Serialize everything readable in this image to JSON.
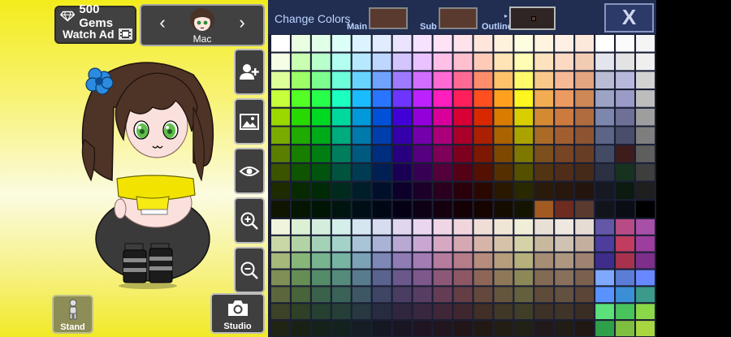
{
  "left": {
    "gems_label": "500 Gems",
    "watch_ad_label": "Watch Ad",
    "character_name": "Mac",
    "stand_label": "Stand",
    "studio_label": "Studio"
  },
  "panel": {
    "title": "Change Colors",
    "main_label": "Main",
    "sub_label": "Sub",
    "outline_label": "Outline",
    "close_label": "X",
    "main_color": "#5a3a2e",
    "sub_color": "#5a3a2e",
    "outline_color": "#2e2524"
  },
  "palette": {
    "upper_rows": [
      [
        "#ffffff",
        "#eaffe0",
        "#e2ffe8",
        "#dcfff8",
        "#dcf4ff",
        "#e2ecff",
        "#ece4ff",
        "#f6e2ff",
        "#ffe2f6",
        "#ffe2ea",
        "#ffe6dc",
        "#fff2dc",
        "#fffde0",
        "#fff4e0",
        "#fff0e6",
        "#fde8dc",
        "#ffffff",
        "#fbfbfb",
        "#f5f5f5"
      ],
      [
        "#f4ffe6",
        "#c9ffb1",
        "#b8ffcb",
        "#b2ffef",
        "#b6e9ff",
        "#bfd6ff",
        "#d4c5ff",
        "#e9c2ff",
        "#ffbfe7",
        "#ffbfce",
        "#ffcbb6",
        "#ffe4b6",
        "#fffcb4",
        "#fde3bd",
        "#fcd9c2",
        "#f2cbb3",
        "#e4e4ec",
        "#e3e3e3",
        "#efefef"
      ],
      [
        "#ddff9a",
        "#9cff67",
        "#7dff8f",
        "#6cffda",
        "#67d4ff",
        "#6fa3ff",
        "#9d7aff",
        "#d26dff",
        "#ff6ad3",
        "#ff6a94",
        "#ff8d6a",
        "#ffc26a",
        "#fff86a",
        "#f9c98a",
        "#f5b996",
        "#e2a57f",
        "#b9bdd4",
        "#b8b8dc",
        "#d2d2d2"
      ],
      [
        "#c6ff3c",
        "#53ff25",
        "#27ff4b",
        "#1bffc1",
        "#1bbcff",
        "#2a75ff",
        "#6d35ff",
        "#bc22ff",
        "#ff1fbd",
        "#ff1f5a",
        "#ff4f1f",
        "#ffa11f",
        "#fff51f",
        "#f2ad52",
        "#ec9a62",
        "#ce8757",
        "#9ca3c4",
        "#9a9bc7",
        "#bdbdbd"
      ],
      [
        "#9bd800",
        "#28d900",
        "#00d922",
        "#00d99e",
        "#0099d9",
        "#0050d9",
        "#4200d9",
        "#9300d9",
        "#d9009a",
        "#d90035",
        "#d92800",
        "#d97c00",
        "#d9cf00",
        "#d48a33",
        "#cd7a3f",
        "#b06c3f",
        "#7d87ad",
        "#6e7095",
        "#9e9e9e"
      ],
      [
        "#7aab00",
        "#1fab00",
        "#00ab1a",
        "#00ab7c",
        "#0079ab",
        "#003fab",
        "#3400ab",
        "#7300ab",
        "#ab0079",
        "#ab002a",
        "#ab2000",
        "#ab6200",
        "#aba300",
        "#a96b26",
        "#a35e30",
        "#8d5432",
        "#5d6586",
        "#4b4d6c",
        "#7e7e7e"
      ],
      [
        "#5a7e00",
        "#177e00",
        "#007e13",
        "#007e5b",
        "#00597e",
        "#002e7e",
        "#26007e",
        "#55007e",
        "#7e0059",
        "#7e001f",
        "#7e1800",
        "#7e4800",
        "#7e7800",
        "#7c4f1c",
        "#774424",
        "#673e25",
        "#434a63",
        "#3f1c1c",
        "#5e5e5e"
      ],
      [
        "#3c5400",
        "#0f5400",
        "#00540d",
        "#00543d",
        "#003b54",
        "#001f54",
        "#1a0054",
        "#380054",
        "#54003b",
        "#540015",
        "#541000",
        "#543000",
        "#545000",
        "#523413",
        "#4f2d18",
        "#452919",
        "#2c3142",
        "#17321f",
        "#3e3e3e"
      ],
      [
        "#1e2a00",
        "#072a00",
        "#002a06",
        "#002a1e",
        "#001e2a",
        "#00102a",
        "#0d002a",
        "#1c002a",
        "#2a001e",
        "#2a000a",
        "#2a0800",
        "#2a1800",
        "#2a2800",
        "#2a1a0a",
        "#28170c",
        "#23150d",
        "#161922",
        "#0c1a10",
        "#1f1f1f"
      ],
      [
        "#0f1500",
        "#041500",
        "#001503",
        "#00150f",
        "#000f15",
        "#000815",
        "#060015",
        "#0e0015",
        "#15000f",
        "#150005",
        "#150400",
        "#150c00",
        "#151400",
        "#a15a21",
        "#6e2b1f",
        "#5a3a2e",
        "#12141c",
        "#0a0d14",
        "#000000"
      ]
    ],
    "lower_rows": [
      [
        "#f0f4dc",
        "#dcf0d4",
        "#d4eede",
        "#d4eeea",
        "#d6e6f0",
        "#d8dcf0",
        "#e0d6ee",
        "#ead6ee",
        "#f0d6e4",
        "#f0d6dc",
        "#f0ddd6",
        "#f0e6d6",
        "#f0eed6",
        "#e8e0d4",
        "#eee8e0",
        "#e6dcd4",
        "#6457a8",
        "#b84b86",
        "#a84fa8"
      ],
      [
        "#c9d6a6",
        "#b2d4a4",
        "#a4d2b6",
        "#a4d2c8",
        "#a8c4d6",
        "#aab2d6",
        "#b8a8d2",
        "#c8a8d2",
        "#d6a8c2",
        "#d6a8b2",
        "#d6b4a8",
        "#d6c2a8",
        "#d6d2a8",
        "#c8b89e",
        "#d0c2b2",
        "#c4ae9e",
        "#4e3d9d",
        "#c13c5e",
        "#9d3d9d"
      ],
      [
        "#a6b87a",
        "#88b678",
        "#78b48e",
        "#78b4a2",
        "#7ca2b6",
        "#7e88b6",
        "#907cb4",
        "#a47cb4",
        "#b67c9e",
        "#b67c88",
        "#b68c7c",
        "#b69e7c",
        "#b6b07c",
        "#a68e74",
        "#ad977f",
        "#9f8370",
        "#3e2d8a",
        "#a8324e",
        "#7d2f8a"
      ],
      [
        "#7f8f56",
        "#658d54",
        "#548b68",
        "#548b7b",
        "#587b8d",
        "#5a638d",
        "#6a588b",
        "#7d588b",
        "#8d5877",
        "#8d5863",
        "#8d6658",
        "#8d7858",
        "#8d8858",
        "#836a52",
        "#88705b",
        "#7c604e",
        "#7fa8ff",
        "#5b7dd6",
        "#6888ff"
      ],
      [
        "#5c663c",
        "#47643a",
        "#3a624a",
        "#3a6257",
        "#3d5764",
        "#3f4564",
        "#4a3d62",
        "#583d62",
        "#643d55",
        "#643d45",
        "#64483d",
        "#64553d",
        "#64603d",
        "#5e4b39",
        "#625040",
        "#5a4536",
        "#5a93ff",
        "#3a8fd6",
        "#3b9a8a"
      ],
      [
        "#3c4226",
        "#2e4025",
        "#253f30",
        "#253f38",
        "#273840",
        "#282c40",
        "#30273f",
        "#39273f",
        "#402737",
        "#40272d",
        "#402e27",
        "#403727",
        "#403e27",
        "#3d3025",
        "#403429",
        "#3a2d23",
        "#5ce07a",
        "#49c45a",
        "#8ad848"
      ],
      [
        "#202414",
        "#182214",
        "#14221a",
        "#14221e",
        "#151e22",
        "#151822",
        "#1a1522",
        "#1f1522",
        "#22151d",
        "#221518",
        "#221915",
        "#221e15",
        "#222115",
        "#21191a",
        "#221c16",
        "#1f1813",
        "#2fa04a",
        "#7fbf3f",
        "#a8d640"
      ]
    ],
    "selected": {
      "section": "upper",
      "row": 9,
      "col": 15
    }
  }
}
